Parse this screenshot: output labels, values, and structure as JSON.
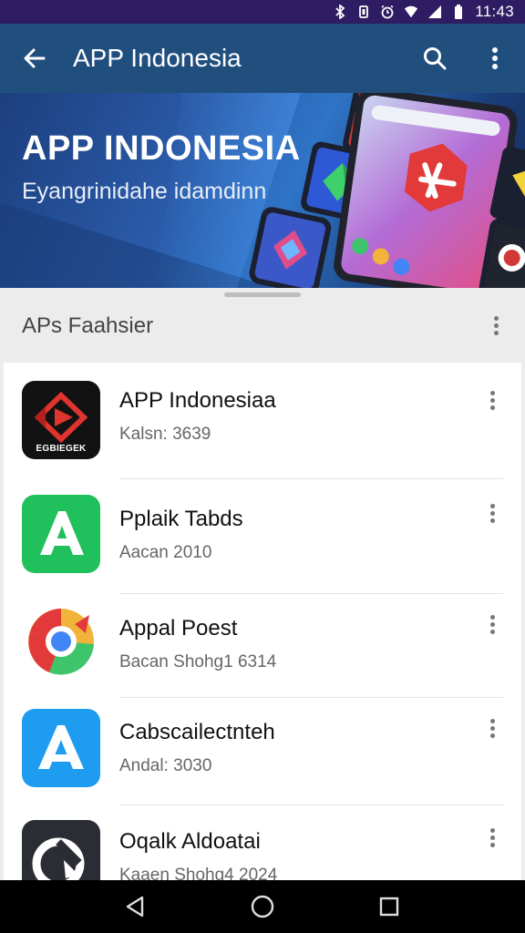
{
  "status_bar": {
    "time": "11:43",
    "icons": [
      "bluetooth-icon",
      "vibrate-icon",
      "alarm-icon",
      "wifi-icon",
      "signal-icon",
      "battery-icon"
    ]
  },
  "app_bar": {
    "title": "APP Indonesia",
    "back_icon": "arrow-back-icon",
    "search_icon": "search-icon",
    "overflow_icon": "more-vert-icon"
  },
  "banner": {
    "title": "APP INDONESIA",
    "subtitle": "Eyangrinidahe idamdinn"
  },
  "section": {
    "title": "APs Faahsier"
  },
  "apps": [
    {
      "name": "APP Indonesiaa",
      "subtitle": "Kalsn: 3639",
      "icon": "red-play-logo-icon",
      "icon_text": "EGBIEGEK"
    },
    {
      "name": "Pplaik Tabds",
      "subtitle": "Aacan 2010",
      "icon": "green-a-logo-icon"
    },
    {
      "name": "Appal Poest",
      "subtitle": "Bacan Shohg1 6314",
      "icon": "multicolor-circle-logo-icon"
    },
    {
      "name": "Cabscailectnteh",
      "subtitle": "Andal: 3030",
      "icon": "blue-a-logo-icon"
    },
    {
      "name": "Oqalk Aldoatai",
      "subtitle": "Kaaen Shohg4 2024",
      "icon": "dark-swirl-logo-icon"
    }
  ],
  "nav_bar": {
    "back": "nav-back-icon",
    "home": "nav-home-icon",
    "recents": "nav-recents-icon"
  },
  "colors": {
    "status_bar": "#2f1d63",
    "app_bar": "#204f7e",
    "green_icon": "#20c05c",
    "blue_icon": "#1e9cf0"
  }
}
